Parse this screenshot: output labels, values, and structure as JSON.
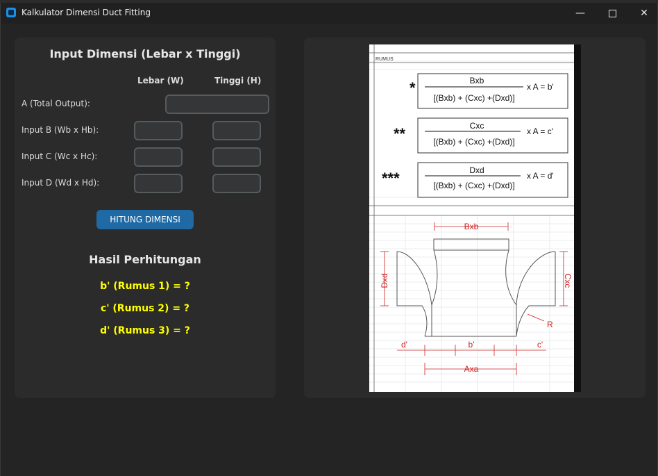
{
  "window": {
    "title": "Kalkulator Dimensi Duct Fitting",
    "minimize_icon": "minimize-icon",
    "maximize_icon": "maximize-icon",
    "close_icon": "close-icon"
  },
  "input_panel": {
    "title": "Input Dimensi (Lebar x Tinggi)",
    "col_width": "Lebar (W)",
    "col_height": "Tinggi (H)",
    "rows": [
      {
        "label": "A (Total Output):",
        "width_value": "",
        "height_value": ""
      },
      {
        "label": "Input B (Wb x Hb):",
        "width_value": "",
        "height_value": ""
      },
      {
        "label": "Input C (Wc x Hc):",
        "width_value": "",
        "height_value": ""
      },
      {
        "label": "Input D (Wd x Hd):",
        "width_value": "",
        "height_value": ""
      }
    ],
    "calc_button": "HITUNG DIMENSI"
  },
  "results": {
    "title": "Hasil Perhitungan",
    "b": "b' (Rumus 1) = ?",
    "c": "c' (Rumus 2) = ?",
    "d": "d' (Rumus 3) = ?",
    "color": "#ffff00"
  },
  "reference": {
    "section_label": "RUMUS",
    "formulas": [
      {
        "mark": "*",
        "numerator": "Bxb",
        "denominator": "[(Bxb) + (Cxc) +(Dxd)]",
        "suffix": "x A  = b'"
      },
      {
        "mark": "**",
        "numerator": "Cxc",
        "denominator": "[(Bxb) + (Cxc) +(Dxd)]",
        "suffix": "x A  = c'"
      },
      {
        "mark": "***",
        "numerator": "Dxd",
        "denominator": "[(Bxb) + (Cxc) +(Dxd)]",
        "suffix": "x A  = d'"
      }
    ],
    "diagram": {
      "top": "Bxb",
      "left": "Dxd",
      "right": "Cxc",
      "radius": "R",
      "d_prime": "d'",
      "b_prime": "b'",
      "c_prime": "c'",
      "bottom": "Axa"
    },
    "dim_color": "#cc2222"
  },
  "colors": {
    "accent": "#1f6aa5",
    "panel": "#2b2b2b",
    "window": "#242424"
  }
}
